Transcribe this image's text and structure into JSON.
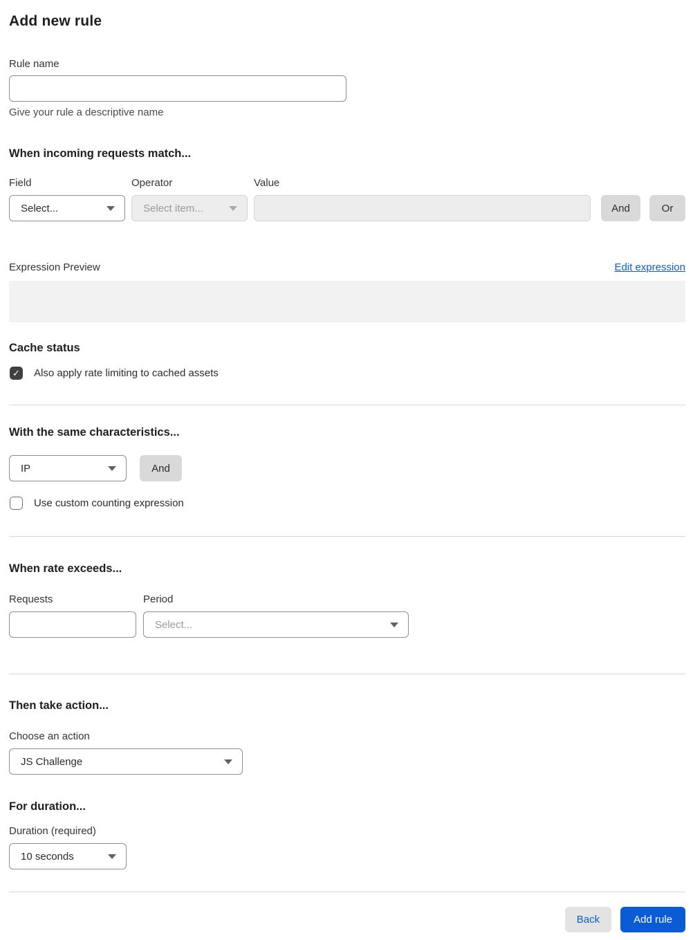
{
  "page": {
    "title": "Add new rule"
  },
  "rule_name": {
    "label": "Rule name",
    "value": "",
    "helper": "Give your rule a descriptive name"
  },
  "match_section": {
    "heading": "When incoming requests match...",
    "field_label": "Field",
    "field_value": "Select...",
    "operator_label": "Operator",
    "operator_placeholder": "Select item...",
    "value_label": "Value",
    "value_text": "",
    "and_button": "And",
    "or_button": "Or"
  },
  "expression": {
    "label": "Expression Preview",
    "edit_link": "Edit expression",
    "preview_text": ""
  },
  "cache_status": {
    "heading": "Cache status",
    "checkbox_label": "Also apply rate limiting to cached assets",
    "checked": true,
    "check_glyph": "✓"
  },
  "characteristics": {
    "heading": "With the same characteristics...",
    "select_value": "IP",
    "and_button": "And",
    "checkbox_label": "Use custom counting expression",
    "checked": false
  },
  "rate": {
    "heading": "When rate exceeds...",
    "requests_label": "Requests",
    "requests_value": "",
    "period_label": "Period",
    "period_placeholder": "Select..."
  },
  "action": {
    "heading": "Then take action...",
    "label": "Choose an action",
    "value": "JS Challenge"
  },
  "duration": {
    "heading": "For duration...",
    "label": "Duration (required)",
    "value": "10 seconds"
  },
  "footer": {
    "back_button": "Back",
    "submit_button": "Add rule"
  },
  "colors": {
    "accent_blue": "#0b5bd7",
    "button_gray": "#d9d9d9",
    "disabled_bg": "#ededed",
    "preview_bg": "#f2f2f2",
    "checkbox_checked": "#3f4242"
  }
}
